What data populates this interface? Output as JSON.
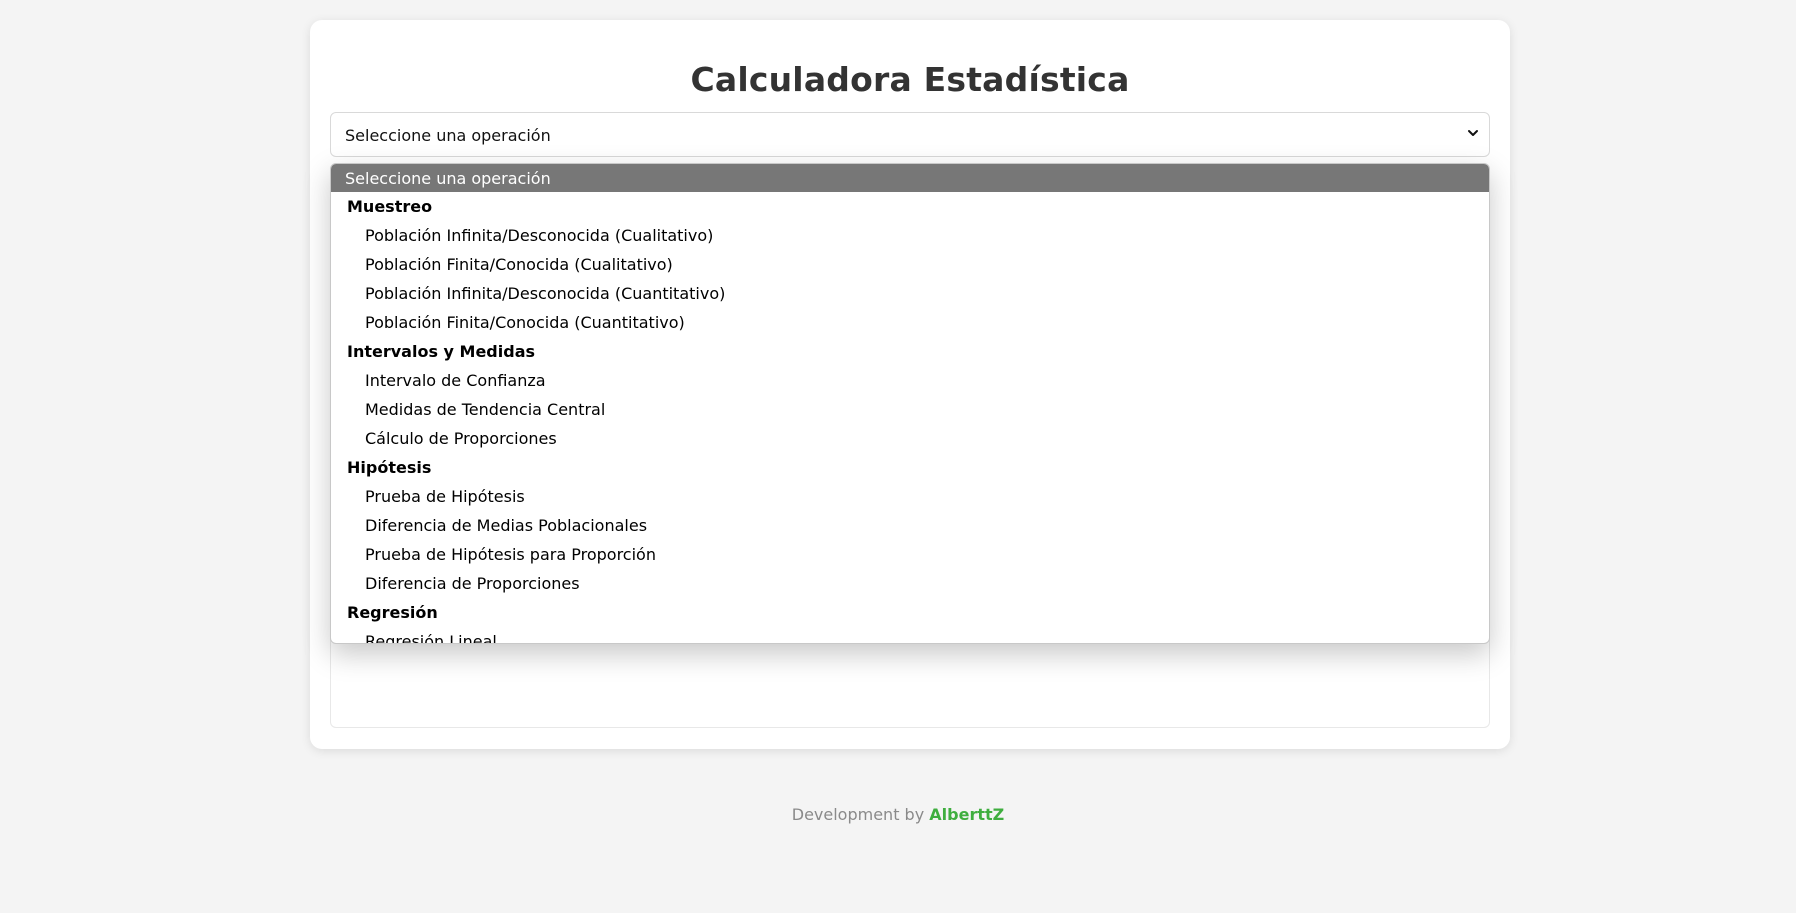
{
  "app": {
    "title": "Calculadora Estadística"
  },
  "operation_select": {
    "selected_label": "Seleccione una operación",
    "arrow_icon": "chevron-down-icon"
  },
  "dropdown": {
    "placeholder": "Seleccione una operación",
    "groups": [
      {
        "label": "Muestreo",
        "options": [
          "Población Infinita/Desconocida (Cualitativo)",
          "Población Finita/Conocida (Cualitativo)",
          "Población Infinita/Desconocida (Cuantitativo)",
          "Población Finita/Conocida (Cuantitativo)"
        ]
      },
      {
        "label": "Intervalos y Medidas",
        "options": [
          "Intervalo de Confianza",
          "Medidas de Tendencia Central",
          "Cálculo de Proporciones"
        ]
      },
      {
        "label": "Hipótesis",
        "options": [
          "Prueba de Hipótesis",
          "Diferencia de Medias Poblacionales",
          "Prueba de Hipótesis para Proporción",
          "Diferencia de Proporciones"
        ]
      },
      {
        "label": "Regresión",
        "options": [
          "Regresión Lineal"
        ]
      }
    ]
  },
  "footer": {
    "prefix": "Development by ",
    "author": "AlberttZ"
  },
  "colors": {
    "page_background": "#f4f4f4",
    "card_background": "#ffffff",
    "title_text": "#333333",
    "selected_option_background": "#777777",
    "footer_text": "#8a8a8a",
    "author_accent": "#3fae3f"
  }
}
